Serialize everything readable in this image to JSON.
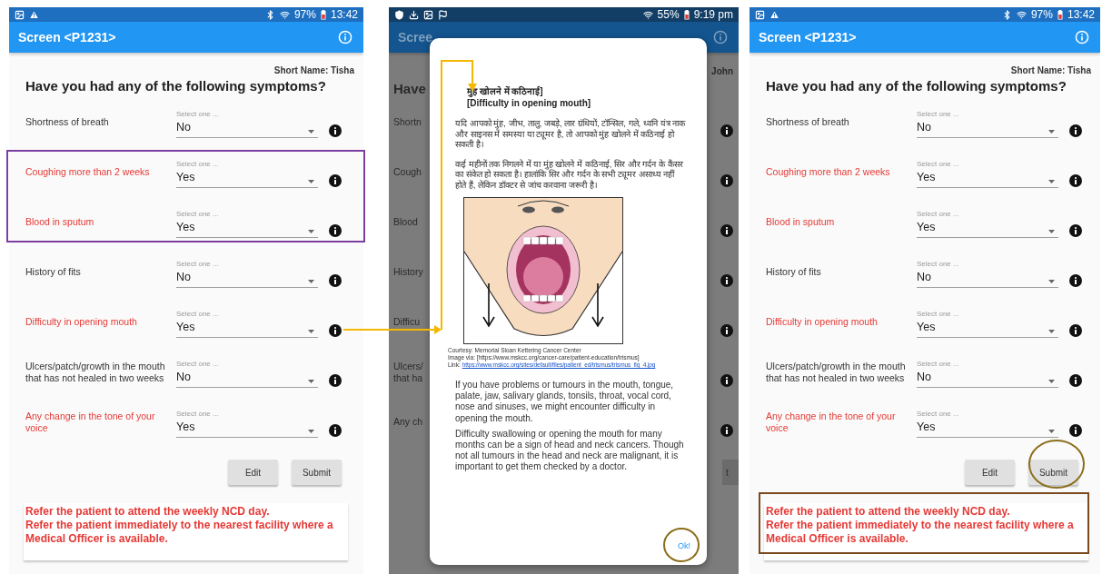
{
  "panels": [
    {
      "kind": "form",
      "status_bar": {
        "battery": "97%",
        "time": "13:42"
      },
      "app_bar": {
        "title": "Screen <P1231>"
      },
      "short_name": "Short Name: Tisha",
      "question": "Have you had any of the following symptoms?",
      "rows": [
        {
          "label": "Shortness of breath",
          "hint": "Select one ...",
          "value": "No",
          "highlighted": false
        },
        {
          "label": "Coughing more than 2 weeks",
          "hint": "Select one ...",
          "value": "Yes",
          "highlighted": true
        },
        {
          "label": "Blood in sputum",
          "hint": "Select one ...",
          "value": "Yes",
          "highlighted": true
        },
        {
          "label": "History of fits",
          "hint": "Select one ...",
          "value": "No",
          "highlighted": false
        },
        {
          "label": "Difficulty in opening mouth",
          "hint": "Select one ...",
          "value": "Yes",
          "highlighted": true
        },
        {
          "label": "Ulcers/patch/growth in the mouth that has not healed in two weeks",
          "hint": "Select one ...",
          "value": "No",
          "highlighted": false
        },
        {
          "label": "Any change in the tone of your voice",
          "hint": "Select one ...",
          "value": "Yes",
          "highlighted": true
        }
      ],
      "buttons": [
        "Edit",
        "Submit"
      ],
      "message": [
        "Refer the patient to attend the weekly NCD day.",
        "Refer the patient immediately to the nearest facility where a Medical Officer is available."
      ]
    },
    {
      "kind": "dialog",
      "status_bar": {
        "battery": "55%",
        "time": "9:19 pm"
      },
      "app_bar": {
        "title": "Scree"
      },
      "short_name": "John",
      "question": "Have",
      "rows": [
        {
          "lines": [
            "Shortn"
          ]
        },
        {
          "lines": [
            "Cough"
          ]
        },
        {
          "lines": [
            "Blood"
          ]
        },
        {
          "lines": [
            "History"
          ]
        },
        {
          "lines": [
            "Difficu"
          ]
        },
        {
          "lines": [
            "Ulcers/",
            "that ha"
          ]
        },
        {
          "lines": [
            "Any ch"
          ]
        }
      ],
      "button": "t",
      "dialog": {
        "title_hindi": "मुंह खोलने में कठिनाई]",
        "title_english": "[Difficulty in opening mouth]",
        "hindi_paragraphs": [
          "यदि आपको मुंह, जीभ, तालु, जबड़े, लार ग्रंथियों, टॉन्सिल, गले, ध्वनि यंत्र नाक और साइनस में समस्या या ट्यूमर है, तो आपको मुंह खोलने में कठिनाई हो सकती है।",
          "कई महीनों तक निगलने में  या मुंह खोलने में कठिनाई, सिर और गर्दन के कैंसर का संकेत हो सकता है। हालांकि सिर और गर्दन के सभी ट्यूमर असाध्य नहीं होते हैं, लेकिन डॉक्टर से जांच करवाना जरूरी है।"
        ],
        "caption": [
          "Courtesy: Memorial Sloan Kettering Cancer Center",
          "Image via: [https://www.mskcc.org/cancer-care/patient-education/trismus]"
        ],
        "caption_link_label": "Link:",
        "caption_link": "https://www.mskcc.org/sites/default/files/patient_ed/trismus/trismus_fig_4.jpg",
        "english_paragraphs": [
          "If you have problems or tumours in the mouth, tongue, palate, jaw, salivary glands, tonsils, throat, vocal cord, nose and sinuses, we might encounter difficulty in opening the mouth.",
          "Difficulty swallowing or opening the mouth for many months can be a sign of head and neck cancers. Though not all tumours in the head and neck are malignant, it is important to get them checked by a doctor."
        ],
        "ok_button": "Ok!"
      }
    },
    {
      "kind": "form",
      "status_bar": {
        "battery": "97%",
        "time": "13:42"
      },
      "app_bar": {
        "title": "Screen <P1231>"
      },
      "short_name": "Short Name: Tisha",
      "question": "Have you had any of the following symptoms?",
      "rows": [
        {
          "label": "Shortness of breath",
          "hint": "Select one ...",
          "value": "No",
          "highlighted": false
        },
        {
          "label": "Coughing more than 2 weeks",
          "hint": "Select one ...",
          "value": "Yes",
          "highlighted": true
        },
        {
          "label": "Blood in sputum",
          "hint": "Select one ...",
          "value": "Yes",
          "highlighted": true
        },
        {
          "label": "History of fits",
          "hint": "Select one ...",
          "value": "No",
          "highlighted": false
        },
        {
          "label": "Difficulty in opening mouth",
          "hint": "Select one ...",
          "value": "Yes",
          "highlighted": true
        },
        {
          "label": "Ulcers/patch/growth in the mouth that has not healed in two weeks",
          "hint": "Select one ...",
          "value": "No",
          "highlighted": false
        },
        {
          "label": "Any change in the tone of your voice",
          "hint": "Select one ...",
          "value": "Yes",
          "highlighted": true
        }
      ],
      "buttons": [
        "Edit",
        "Submit"
      ],
      "message": [
        "Refer the patient to attend the weekly NCD day.",
        "Refer the patient immediately to the nearest facility where a Medical Officer is available."
      ]
    }
  ]
}
